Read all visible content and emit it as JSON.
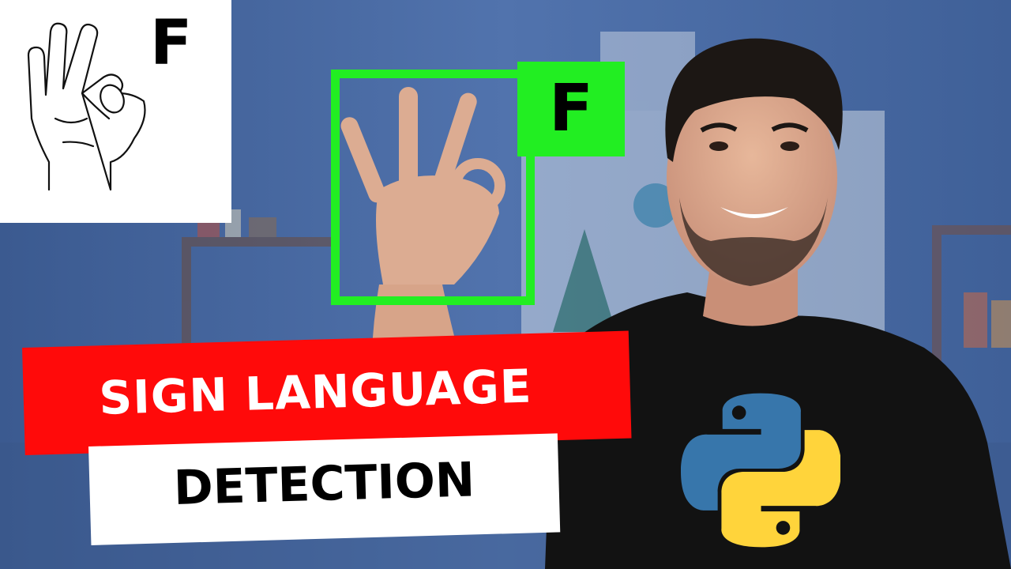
{
  "sign_card": {
    "letter": "F",
    "illustration": "hand-sign-f-illustration"
  },
  "detection": {
    "label": "F",
    "box_color": "#22ee22"
  },
  "title": {
    "line1": "SIGN LANGUAGE",
    "line2": "DETECTION",
    "line1_bg": "#ff0a0a",
    "line2_bg": "#ffffff"
  },
  "logo": {
    "icon": "python-logo-icon",
    "colors": [
      "#3776ab",
      "#ffd43b"
    ]
  },
  "photo": {
    "subject": "person-raising-hand",
    "background_color": "#4b6aa3"
  }
}
